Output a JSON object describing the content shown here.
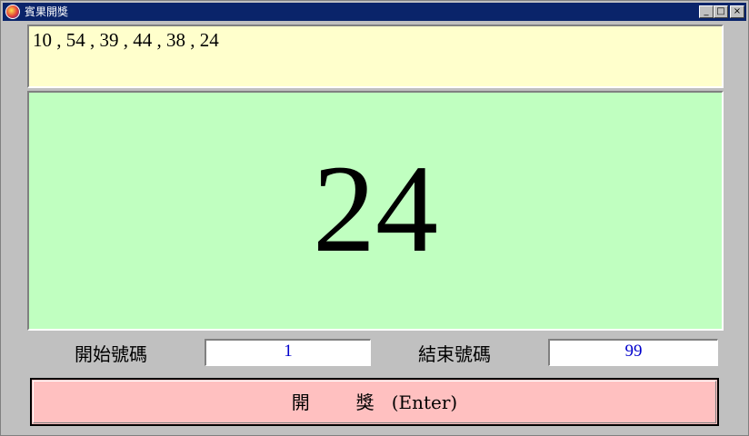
{
  "window": {
    "title": "賓果開獎",
    "controls": {
      "minimize": "_",
      "maximize": "□",
      "close": "×"
    }
  },
  "history": {
    "text": "10 , 54 , 39 , 44 , 38 , 24"
  },
  "display": {
    "current_number": "24"
  },
  "range": {
    "start_label": "開始號碼",
    "start_value": "1",
    "end_label": "結束號碼",
    "end_value": "99"
  },
  "draw_button": {
    "label": "開        獎   (Enter)"
  },
  "colors": {
    "history_bg": "#ffffcc",
    "display_bg": "#c0ffc0",
    "button_bg": "#ffc0c0",
    "field_text": "#0000cc"
  }
}
